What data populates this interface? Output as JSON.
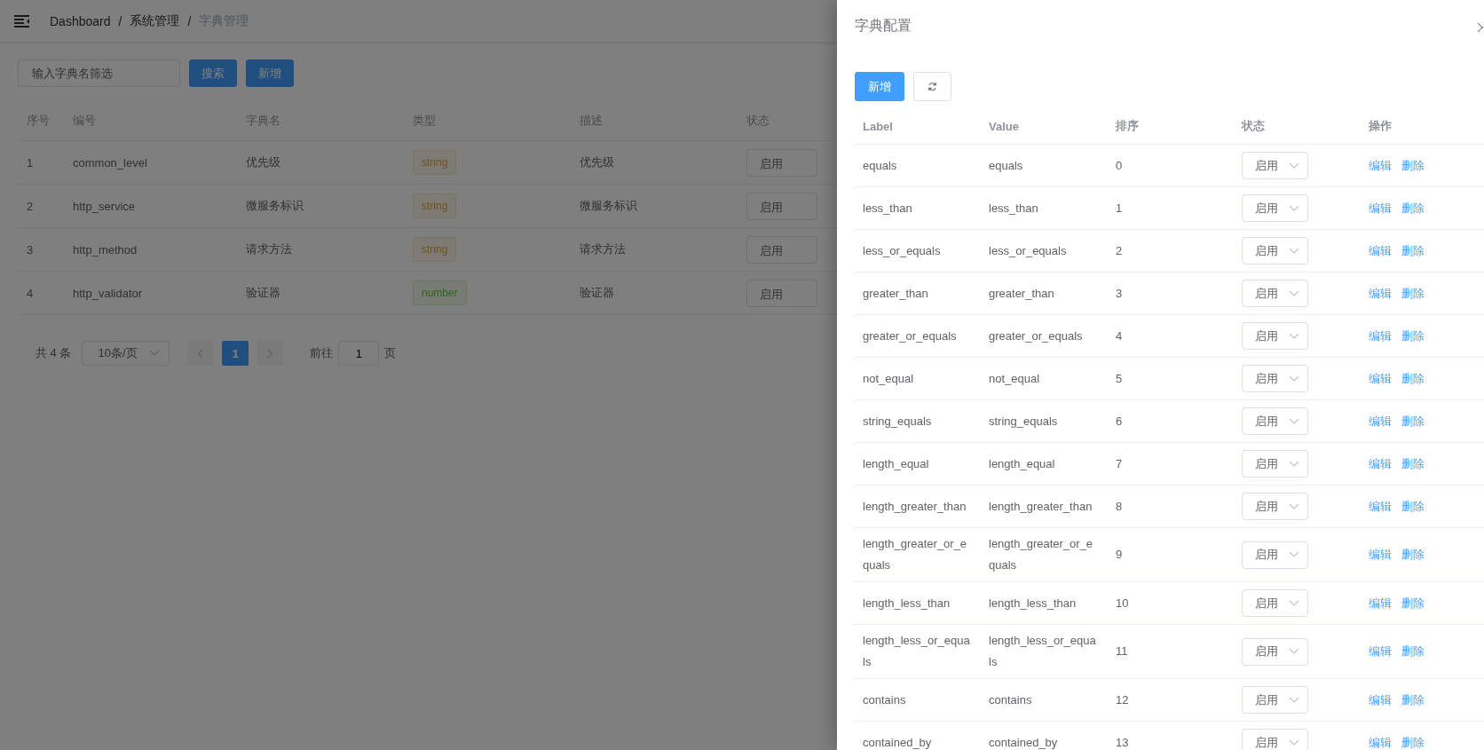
{
  "breadcrumb": {
    "separator": "/",
    "items": [
      {
        "label": "Dashboard",
        "current": false
      },
      {
        "label": "系统管理",
        "current": false
      },
      {
        "label": "字典管理",
        "current": true
      }
    ]
  },
  "filter": {
    "placeholder": "输入字典名筛选"
  },
  "toolbar_buttons": [
    "搜索",
    "新增"
  ],
  "table": {
    "columns": [
      "序号",
      "编号",
      "字典名",
      "类型",
      "描述",
      "状态"
    ],
    "rows": [
      {
        "index": "1",
        "code": "common_level",
        "name": "优先级",
        "type": {
          "label": "string",
          "kind": "warning"
        },
        "description": "优先级",
        "status": "启用"
      },
      {
        "index": "2",
        "code": "http_service",
        "name": "微服务标识",
        "type": {
          "label": "string",
          "kind": "warning"
        },
        "description": "微服务标识",
        "status": "启用"
      },
      {
        "index": "3",
        "code": "http_method",
        "name": "请求方法",
        "type": {
          "label": "string",
          "kind": "warning"
        },
        "description": "请求方法",
        "status": "启用"
      },
      {
        "index": "4",
        "code": "http_validator",
        "name": "验证器",
        "type": {
          "label": "number",
          "kind": "success"
        },
        "description": "验证器",
        "status": "启用"
      }
    ]
  },
  "pagination": {
    "total": "共 4 条",
    "page_size": "10条/页",
    "pages": [
      {
        "label": "1",
        "selected": true
      }
    ],
    "goto_label": "前往",
    "goto_value": "1",
    "goto_suffix": "页"
  },
  "drawer": {
    "title": "字典配置",
    "add_button": "新增",
    "columns": [
      "Label",
      "Value",
      "排序",
      "状态",
      "操作"
    ],
    "rows": [
      {
        "label": "equals",
        "value": "equals",
        "order": "0",
        "status": "启用",
        "actions": [
          "编辑",
          "删除"
        ]
      },
      {
        "label": "less_than",
        "value": "less_than",
        "order": "1",
        "status": "启用",
        "actions": [
          "编辑",
          "删除"
        ]
      },
      {
        "label": "less_or_equals",
        "value": "less_or_equals",
        "order": "2",
        "status": "启用",
        "actions": [
          "编辑",
          "删除"
        ]
      },
      {
        "label": "greater_than",
        "value": "greater_than",
        "order": "3",
        "status": "启用",
        "actions": [
          "编辑",
          "删除"
        ]
      },
      {
        "label": "greater_or_equals",
        "value": "greater_or_equals",
        "order": "4",
        "status": "启用",
        "actions": [
          "编辑",
          "删除"
        ]
      },
      {
        "label": "not_equal",
        "value": "not_equal",
        "order": "5",
        "status": "启用",
        "actions": [
          "编辑",
          "删除"
        ]
      },
      {
        "label": "string_equals",
        "value": "string_equals",
        "order": "6",
        "status": "启用",
        "actions": [
          "编辑",
          "删除"
        ]
      },
      {
        "label": "length_equal",
        "value": "length_equal",
        "order": "7",
        "status": "启用",
        "actions": [
          "编辑",
          "删除"
        ]
      },
      {
        "label": "length_greater_than",
        "value": "length_greater_than",
        "order": "8",
        "status": "启用",
        "actions": [
          "编辑",
          "删除"
        ]
      },
      {
        "label": "length_greater_or_equals",
        "value": "length_greater_or_equals",
        "order": "9",
        "status": "启用",
        "actions": [
          "编辑",
          "删除"
        ]
      },
      {
        "label": "length_less_than",
        "value": "length_less_than",
        "order": "10",
        "status": "启用",
        "actions": [
          "编辑",
          "删除"
        ]
      },
      {
        "label": "length_less_or_equals",
        "value": "length_less_or_equals",
        "order": "11",
        "status": "启用",
        "actions": [
          "编辑",
          "删除"
        ]
      },
      {
        "label": "contains",
        "value": "contains",
        "order": "12",
        "status": "启用",
        "actions": [
          "编辑",
          "删除"
        ]
      },
      {
        "label": "contained_by",
        "value": "contained_by",
        "order": "13",
        "status": "启用",
        "actions": [
          "编辑",
          "删除"
        ]
      }
    ]
  }
}
